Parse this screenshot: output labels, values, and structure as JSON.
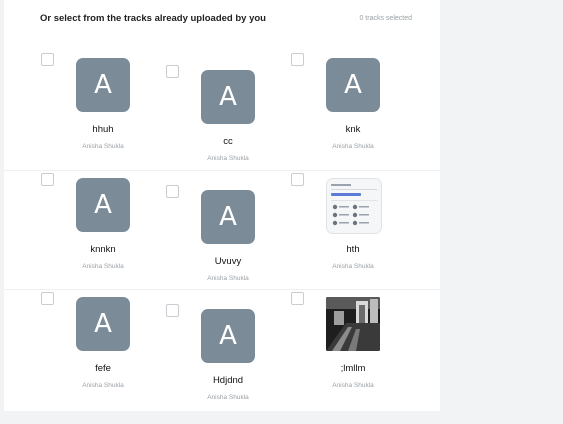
{
  "header": {
    "title": "Or select from the tracks already uploaded by you",
    "selected_count": "0 tracks selected"
  },
  "tracks": [
    {
      "initial": "A",
      "name": "hhuh",
      "artist": "Anisha Shukla",
      "thumbnail": "avatar-initial"
    },
    {
      "initial": "A",
      "name": "cc",
      "artist": "Anisha Shukla",
      "thumbnail": "avatar-initial"
    },
    {
      "initial": "A",
      "name": "knk",
      "artist": "Anisha Shukla",
      "thumbnail": "avatar-initial"
    },
    {
      "initial": "A",
      "name": "knnkn",
      "artist": "Anisha Shukla",
      "thumbnail": "avatar-initial"
    },
    {
      "initial": "A",
      "name": "Uvuvy",
      "artist": "Anisha Shukla",
      "thumbnail": "avatar-initial"
    },
    {
      "initial": "",
      "name": "hth",
      "artist": "Anisha Shukla",
      "thumbnail": "screenshot-image"
    },
    {
      "initial": "A",
      "name": "fefe",
      "artist": "Anisha Shukla",
      "thumbnail": "avatar-initial"
    },
    {
      "initial": "A",
      "name": "Hdjdnd",
      "artist": "Anisha Shukla",
      "thumbnail": "avatar-initial"
    },
    {
      "initial": "",
      "name": ";lmllm",
      "artist": "Anisha Shukla",
      "thumbnail": "photo-image"
    }
  ],
  "colors": {
    "avatar_bg": "#7b8b97",
    "checkbox_border": "#c9ccd1",
    "muted_text": "#9aa0a6"
  }
}
